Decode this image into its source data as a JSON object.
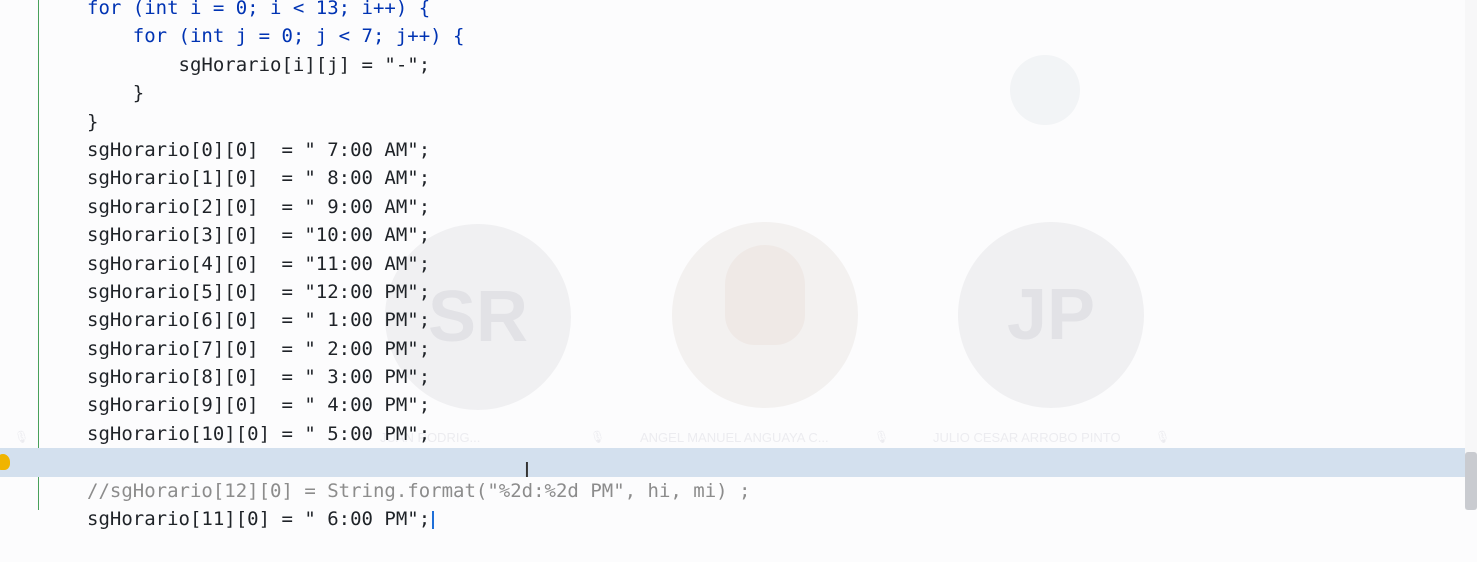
{
  "participants": {
    "avatar_left_initials": "SR",
    "avatar_right_initials": "JP",
    "name_1": "JUAN RODRIG...",
    "name_2": "ANGEL MANUEL ANGUAYA C...",
    "name_3": "JULIO CESAR ARROBO PINTO"
  },
  "code": {
    "line_for_outer": "for (int i = 0; i < 13; i++) {",
    "line_for_inner": "    for (int j = 0; j < 7; j++) {",
    "line_assign_dash": "        sgHorario[i][j] = \"-\";",
    "line_close_inner": "    }",
    "line_close_outer": "}",
    "rows": [
      "sgHorario[0][0]  = \" 7:00 AM\";",
      "sgHorario[1][0]  = \" 8:00 AM\";",
      "sgHorario[2][0]  = \" 9:00 AM\";",
      "sgHorario[3][0]  = \"10:00 AM\";",
      "sgHorario[4][0]  = \"11:00 AM\";",
      "sgHorario[5][0]  = \"12:00 PM\";",
      "sgHorario[6][0]  = \" 1:00 PM\";",
      "sgHorario[7][0]  = \" 2:00 PM\";",
      "sgHorario[8][0]  = \" 3:00 PM\";",
      "sgHorario[9][0]  = \" 4:00 PM\";",
      "sgHorario[10][0] = \" 5:00 PM\";",
      "sgHorario[11][0] = \" 6:00 PM\";"
    ],
    "comment_line": "//sgHorario[12][0] = String.format(\"%2d:%2d PM\", hi, mi) ;"
  }
}
